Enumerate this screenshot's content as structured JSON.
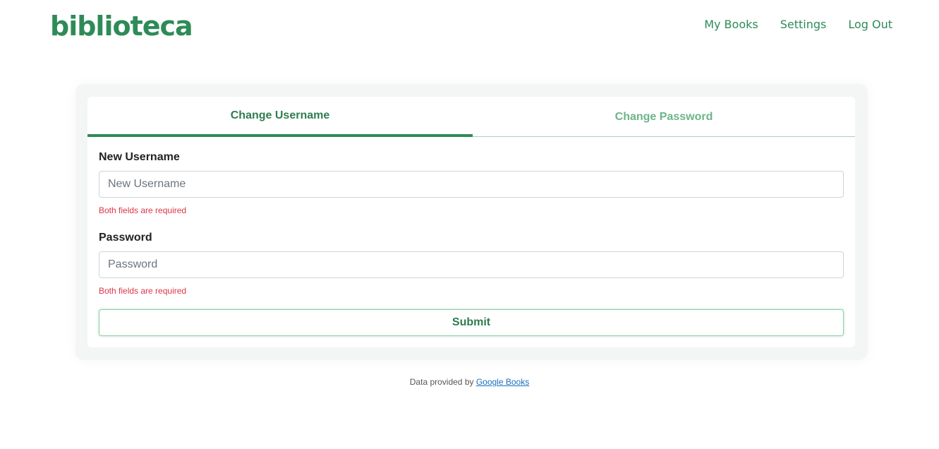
{
  "header": {
    "logo": "biblioteca",
    "nav": [
      {
        "label": "My Books"
      },
      {
        "label": "Settings"
      },
      {
        "label": "Log Out"
      }
    ]
  },
  "tabs": {
    "active": "Change Username",
    "inactive": "Change Password"
  },
  "form": {
    "username_label": "New Username",
    "username_placeholder": "New Username",
    "username_value": "",
    "username_error": "Both fields are required",
    "password_label": "Password",
    "password_placeholder": "Password",
    "password_value": "",
    "password_error": "Both fields are required",
    "submit_label": "Submit"
  },
  "footer": {
    "prefix": "Data provided by ",
    "link": "Google Books"
  },
  "colors": {
    "brand": "#2e8b57",
    "error": "#dc3545",
    "link": "#1a6ec1"
  }
}
